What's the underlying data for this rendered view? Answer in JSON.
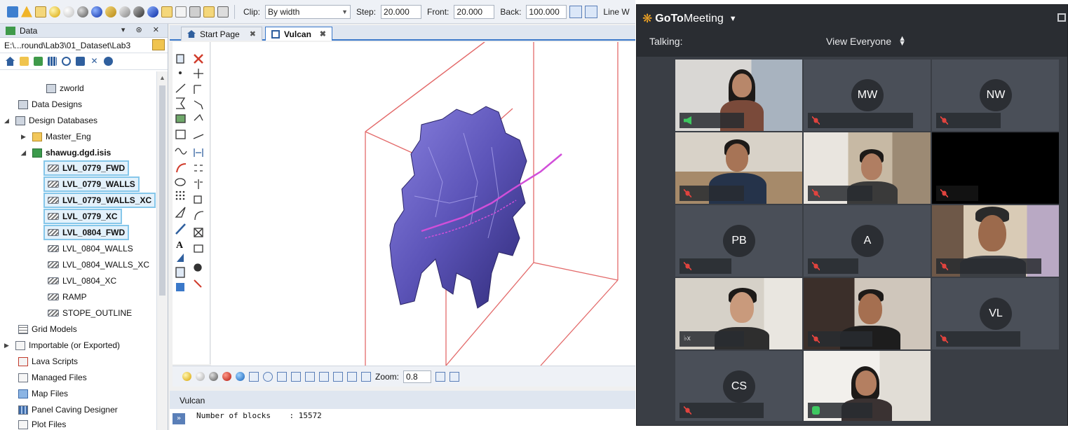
{
  "vulcan": {
    "toolbar": {
      "clip_label": "Clip:",
      "clip_value": "By width",
      "step_label": "Step:",
      "step_value": "20.000",
      "front_label": "Front:",
      "front_value": "20.000",
      "back_label": "Back:",
      "back_value": "100.000",
      "line_label": "Line W"
    },
    "data_panel": {
      "title": "Data",
      "path": "E:\\...round\\Lab3\\01_Dataset\\Lab3"
    },
    "tree": [
      {
        "label": "zworld",
        "icon": "cube-icon"
      },
      {
        "label": "Data Designs",
        "icon": "database-icon"
      },
      {
        "label": "Design Databases",
        "icon": "database-icon"
      },
      {
        "label": "Master_Eng",
        "icon": "folder-icon"
      },
      {
        "label": "shawug.dgd.isis",
        "icon": "lock-icon"
      },
      {
        "label": "LVL_0779_FWD",
        "icon": "layer-icon"
      },
      {
        "label": "LVL_0779_WALLS",
        "icon": "layer-icon"
      },
      {
        "label": "LVL_0779_WALLS_XC",
        "icon": "layer-icon"
      },
      {
        "label": "LVL_0779_XC",
        "icon": "layer-icon"
      },
      {
        "label": "LVL_0804_FWD",
        "icon": "layer-icon"
      },
      {
        "label": "LVL_0804_WALLS",
        "icon": "layer-icon"
      },
      {
        "label": "LVL_0804_WALLS_XC",
        "icon": "layer-icon"
      },
      {
        "label": "LVL_0804_XC",
        "icon": "layer-icon"
      },
      {
        "label": "RAMP",
        "icon": "layer-icon"
      },
      {
        "label": "STOPE_OUTLINE",
        "icon": "layer-icon"
      },
      {
        "label": "Grid Models",
        "icon": "grid-icon"
      },
      {
        "label": "Importable (or Exported)",
        "icon": "import-icon"
      },
      {
        "label": "Lava Scripts",
        "icon": "script-icon"
      },
      {
        "label": "Managed Files",
        "icon": "file-icon"
      },
      {
        "label": "Map Files",
        "icon": "map-icon"
      },
      {
        "label": "Panel Caving Designer",
        "icon": "panel-icon"
      },
      {
        "label": "Plot Files",
        "icon": "plot-icon"
      }
    ],
    "tabs": [
      {
        "label": "Start Page"
      },
      {
        "label": "Vulcan"
      }
    ],
    "bottom_toolbar": {
      "zoom_label": "Zoom:",
      "zoom_value": "0.8"
    },
    "output": {
      "title": "Vulcan",
      "lines": [
        "Number of blocks    : 15572"
      ]
    },
    "colors": {
      "model": "#6a5fc4",
      "clip_box": "#e36a6a",
      "selection": "#86c7ea"
    }
  },
  "gtm": {
    "logo_bold": "GoTo",
    "logo_rest": "Meeting",
    "talking_label": "Talking:",
    "view_label": "View Everyone",
    "tiles": [
      {
        "type": "video",
        "mic": "speaking"
      },
      {
        "type": "initials",
        "initials": "MW",
        "mic": "muted"
      },
      {
        "type": "initials",
        "initials": "NW",
        "mic": "muted"
      },
      {
        "type": "video",
        "mic": "muted"
      },
      {
        "type": "video",
        "mic": "muted"
      },
      {
        "type": "dark",
        "mic": "muted"
      },
      {
        "type": "initials",
        "initials": "PB",
        "mic": "muted"
      },
      {
        "type": "initials",
        "initials": "A",
        "mic": "muted"
      },
      {
        "type": "video",
        "mic": "muted"
      },
      {
        "type": "video",
        "mic": "speaker-off"
      },
      {
        "type": "video",
        "mic": "muted"
      },
      {
        "type": "initials",
        "initials": "VL",
        "mic": "muted"
      },
      {
        "type": "initials",
        "initials": "CS",
        "mic": "muted"
      },
      {
        "type": "video",
        "mic": "live"
      }
    ],
    "colors": {
      "accent": "#f5a623",
      "muted": "#e0433e",
      "live": "#3ec860"
    }
  }
}
